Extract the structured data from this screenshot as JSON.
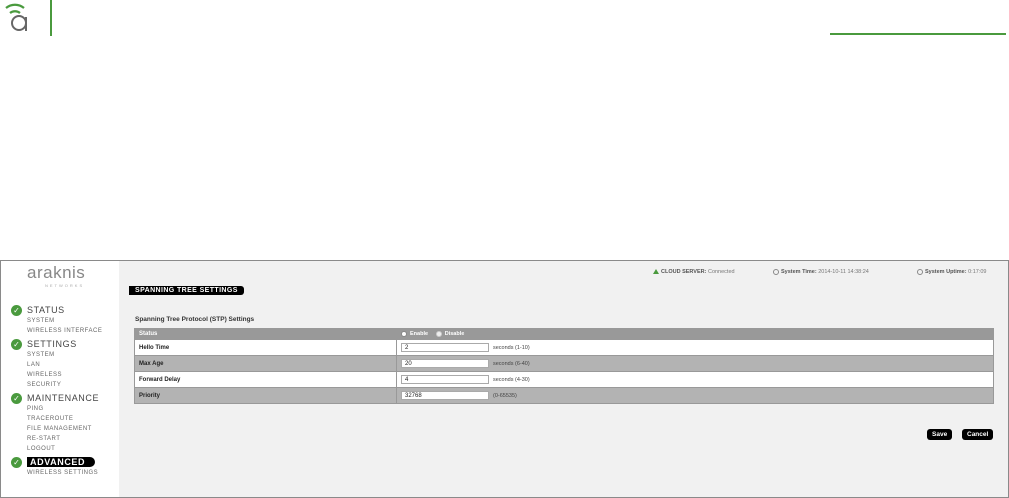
{
  "document": {
    "logo_icon": "araknis-a-logo-icon",
    "accent_color": "#4a9a3e"
  },
  "app": {
    "brand": "araknis",
    "brand_sub": "NETWORKS",
    "status": {
      "cloud_label": "CLOUD SERVER:",
      "cloud_value": "Connected",
      "time_label": "System Time:",
      "time_value": "2014-10-11 14:38:24",
      "uptime_label": "System Uptime:",
      "uptime_value": "0:17:09"
    },
    "nav": [
      {
        "label": "STATUS",
        "items": [
          "SYSTEM",
          "WIRELESS INTERFACE"
        ]
      },
      {
        "label": "SETTINGS",
        "items": [
          "SYSTEM",
          "LAN",
          "WIRELESS",
          "SECURITY"
        ]
      },
      {
        "label": "MAINTENANCE",
        "items": [
          "PING",
          "TRACEROUTE",
          "FILE MANAGEMENT",
          "RE-START",
          "LOGOUT"
        ]
      },
      {
        "label": "ADVANCED",
        "items": [
          "WIRELESS SETTINGS"
        ]
      }
    ],
    "page_title": "SPANNING TREE SETTINGS",
    "section_title": "Spanning Tree Protocol (STP) Settings",
    "status_row": {
      "label": "Status",
      "enable": "Enable",
      "disable": "Disable",
      "selected": "Enable"
    },
    "rows": [
      {
        "label": "Hello Time",
        "value": "2",
        "unit": "seconds (1-10)"
      },
      {
        "label": "Max Age",
        "value": "20",
        "unit": "seconds (6-40)"
      },
      {
        "label": "Forward Delay",
        "value": "4",
        "unit": "seconds (4-30)"
      },
      {
        "label": "Priority",
        "value": "32768",
        "unit": "(0-65535)"
      }
    ],
    "save_label": "Save",
    "cancel_label": "Cancel"
  }
}
